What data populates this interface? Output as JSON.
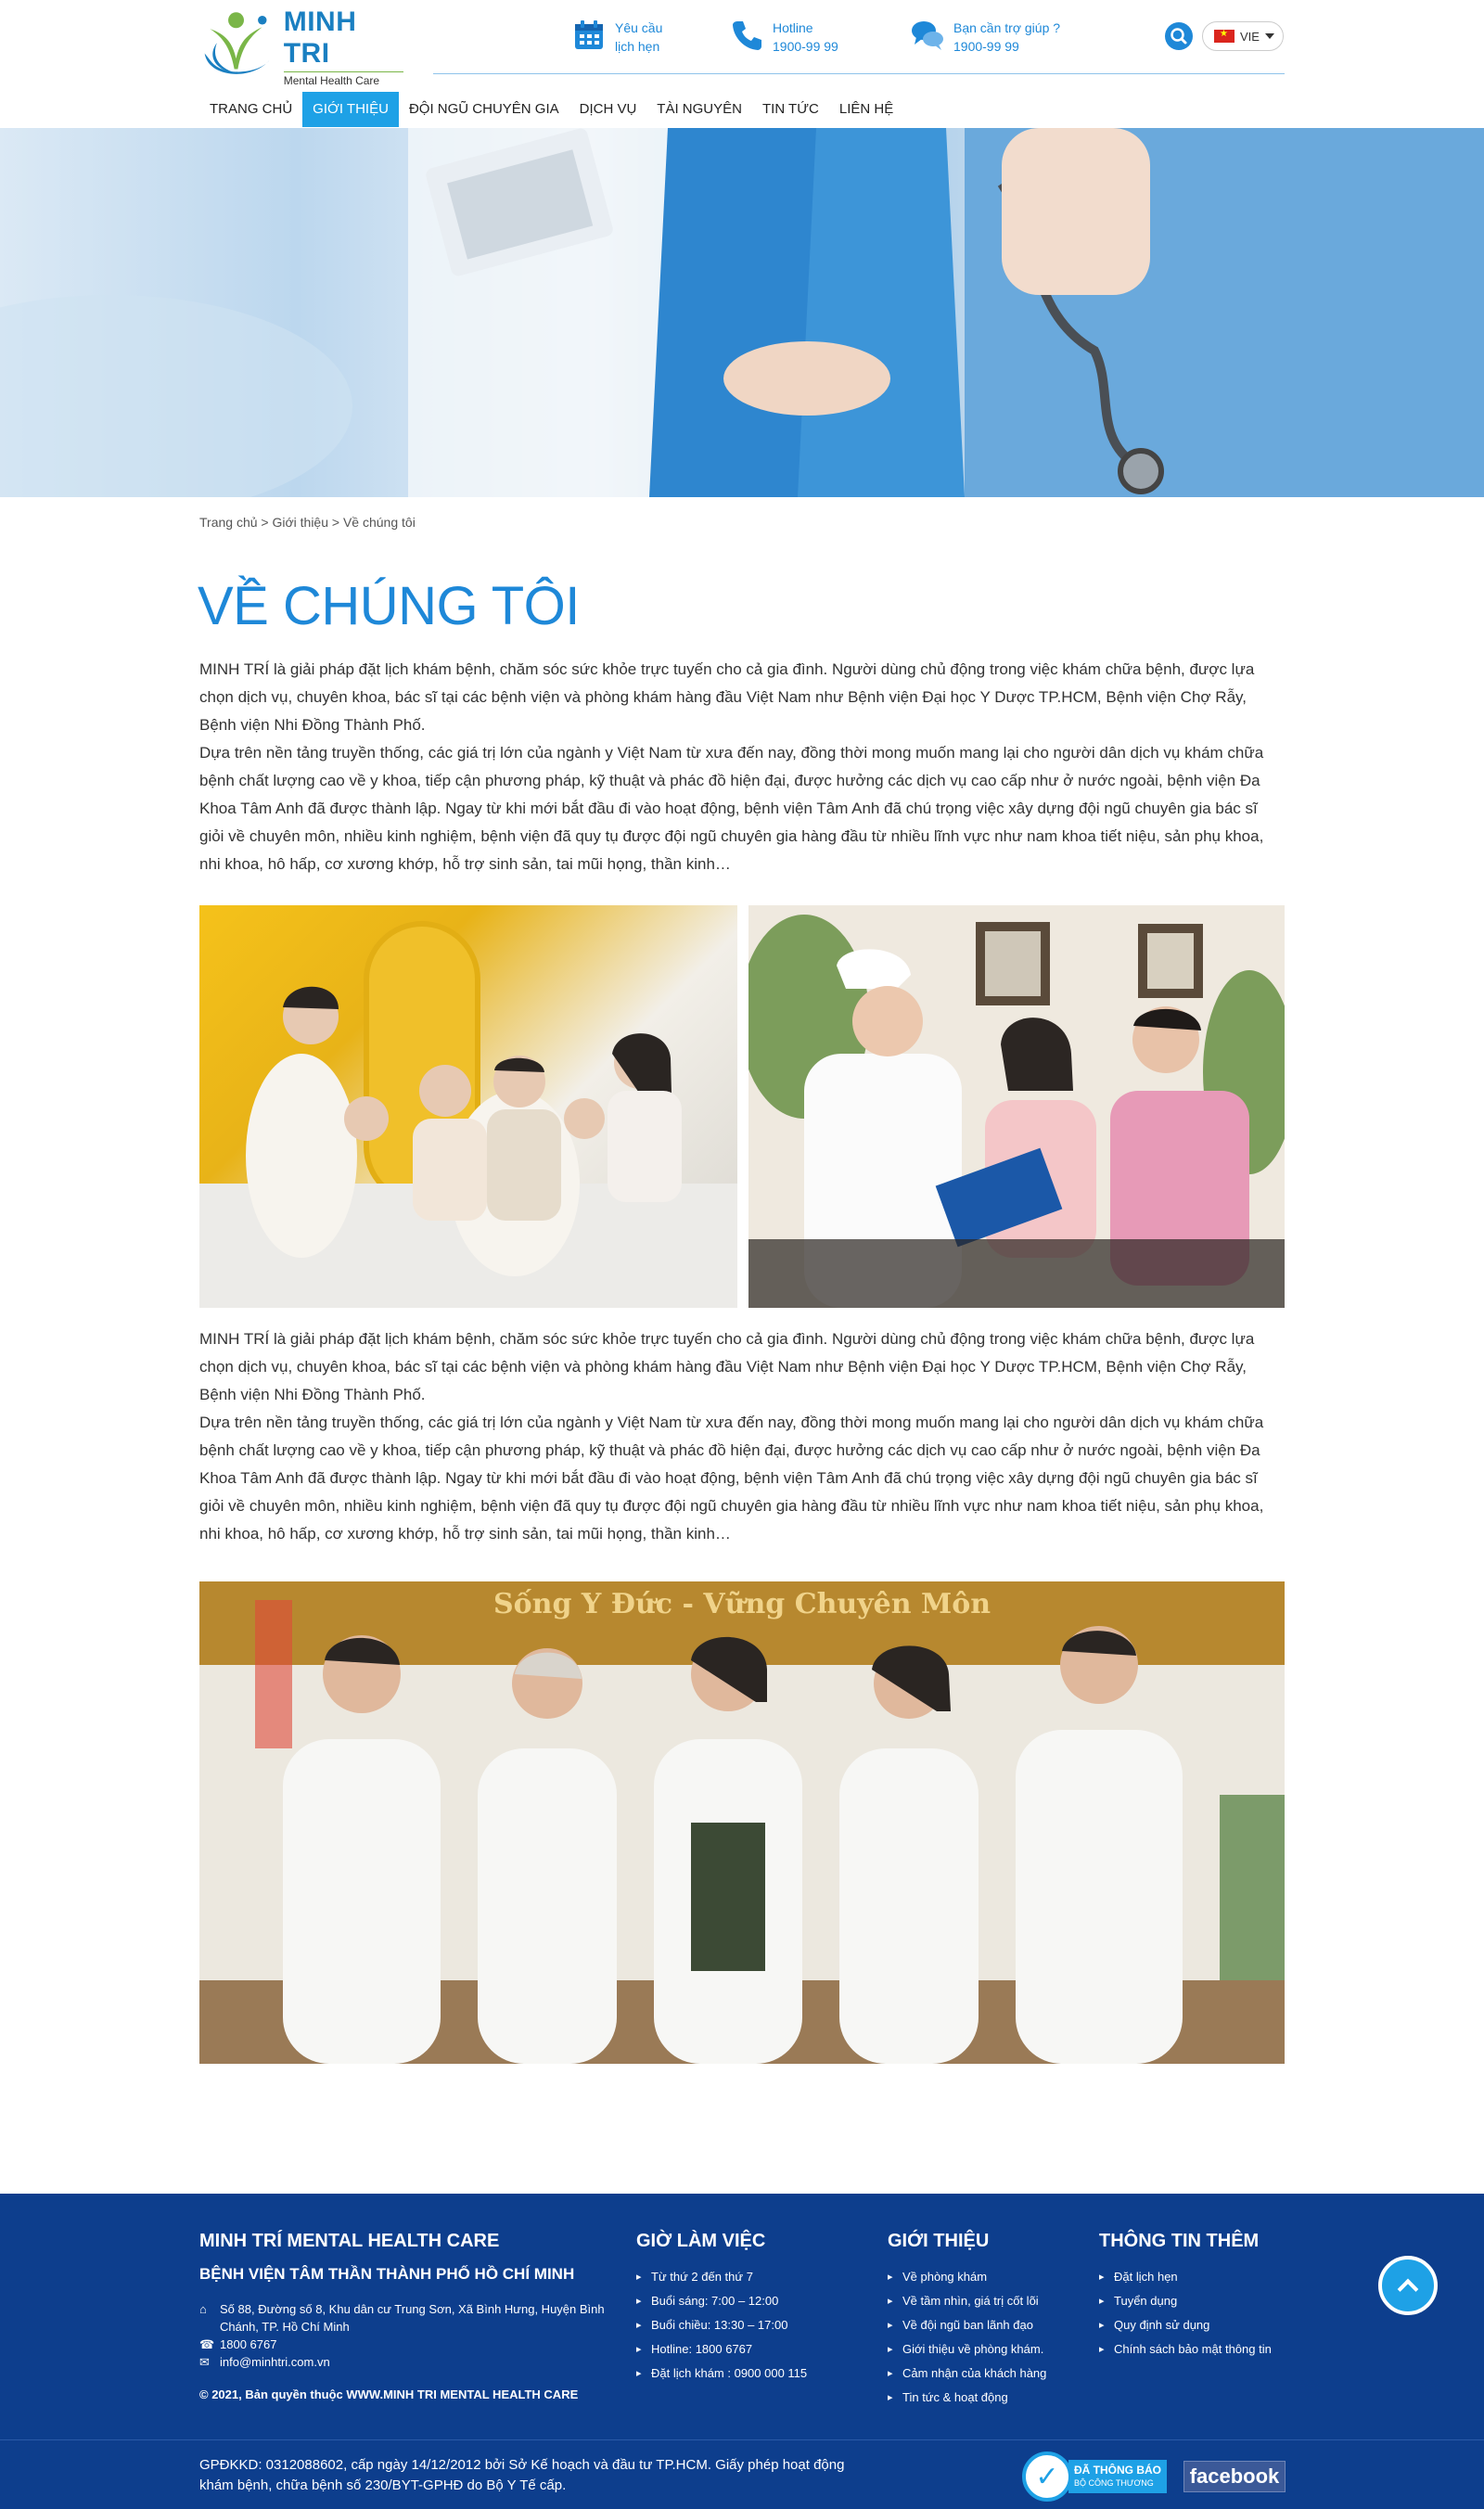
{
  "brand": {
    "name": "MINH TRI",
    "tagline": "Mental Health Care",
    "colors": {
      "primary": "#1e88d8",
      "nav_active": "#1ea1e6",
      "footer_bg": "#0d3e8d",
      "logo_green": "#7ab648"
    }
  },
  "header": {
    "contacts": [
      {
        "icon": "calendar-icon",
        "line1": "Yêu cầu",
        "line2": "lịch hẹn"
      },
      {
        "icon": "phone-icon",
        "line1": "Hotline",
        "line2": "1900-99 99"
      },
      {
        "icon": "chat-icon",
        "line1": "Bạn cần trợ giúp ?",
        "line2": "1900-99 99"
      }
    ],
    "lang": "VIE"
  },
  "nav": {
    "items": [
      "TRANG CHỦ",
      "GIỚI THIỆU",
      "ĐỘI NGŨ CHUYÊN GIA",
      "DỊCH VỤ",
      "TÀI NGUYÊN",
      "TIN TỨC",
      "LIÊN HỆ"
    ],
    "active_index": 1
  },
  "breadcrumb": "Trang chủ > Giới thiệu > Về chúng tôi",
  "page_title": "VỀ CHÚNG TÔI",
  "paragraphs": {
    "intro": "MINH TRÍ là giải pháp đặt lịch khám bệnh, chăm sóc sức khỏe trực tuyến cho cả gia đình. Người dùng chủ động trong việc khám chữa bệnh, được lựa chọn dịch vụ, chuyên khoa, bác sĩ tại các bệnh viện và phòng khám hàng đầu Việt Nam như Bệnh viện Đại học Y Dược TP.HCM, Bệnh viện Chợ Rẫy, Bệnh viện Nhi Đồng Thành Phố.",
    "history": "Dựa trên nền tảng truyền thống, các giá trị lớn của ngành y Việt Nam từ xưa đến nay, đồng thời mong muốn mang lại cho người dân dịch vụ khám chữa bệnh chất lượng cao về y khoa, tiếp cận phương pháp, kỹ thuật và phác đồ hiện đại, được hưởng các dịch vụ cao cấp như ở nước ngoài, bệnh viện Đa Khoa Tâm Anh đã được thành lập. Ngay từ khi mới bắt đầu đi vào hoạt động, bệnh viện Tâm Anh đã chú trọng việc xây dựng đội ngũ chuyên gia bác sĩ giỏi về chuyên môn, nhiều kinh nghiệm, bệnh viện đã quy tụ được đội ngũ chuyên gia hàng đầu từ nhiều lĩnh vực như nam khoa tiết niệu, sản phụ khoa, nhi khoa, hô hấp, cơ xương khớp, hỗ trợ sinh sản, tai mũi họng, thần kinh…"
  },
  "images": {
    "family_photo": "family-photo",
    "nurse_consult_photo": "nurse-consultation-photo",
    "doctors_team_photo": "doctors-team-photo",
    "team_banner_text": "Sống Y Đức - Vững Chuyên Môn"
  },
  "footer": {
    "org_title": "MINH TRÍ MENTAL HEALTH CARE",
    "org_subtitle": "BỆNH VIỆN TÂM THẦN THÀNH PHỐ HỒ CHÍ MINH",
    "address": "Số 88, Đường số 8, Khu dân cư Trung Sơn, Xã Bình Hưng, Huyện Bình Chánh, TP. Hồ Chí Minh",
    "phone": "1800 6767",
    "email": "info@minhtri.com.vn",
    "copyright": "© 2021, Bản quyền thuộc WWW.MINH TRI MENTAL HEALTH CARE",
    "hours": {
      "title": "GIỜ LÀM VIỆC",
      "items": [
        "Từ thứ 2 đến thứ 7",
        "Buổi sáng: 7:00 – 12:00",
        "Buổi chiều: 13:30 – 17:00",
        "Hotline: 1800 6767",
        "Đặt lịch khám : 0900 000 115"
      ]
    },
    "about": {
      "title": "GIỚI THIỆU",
      "items": [
        "Về phòng khám",
        "Về tầm nhìn, giá trị cốt lõi",
        "Về đội ngũ ban lãnh đạo",
        "Giới thiệu về phòng khám.",
        "Cảm nhận của khách hàng",
        "Tin tức & hoạt động"
      ]
    },
    "more": {
      "title": "THÔNG TIN THÊM",
      "items": [
        "Đặt lịch hẹn",
        "Tuyển dụng",
        "Quy định sử dụng",
        "Chính sách bảo mật thông tin"
      ]
    },
    "license": "GPĐKKD: 0312088602, cấp ngày 14/12/2012 bởi Sở Kế hoạch và đầu tư TP.HCM. Giấy phép hoạt động khám bệnh, chữa bệnh số 230/BYT-GPHĐ do Bộ Y Tế cấp.",
    "bct_label": "ĐÃ THÔNG BÁO",
    "bct_sub": "BỘ CÔNG THƯƠNG",
    "facebook_label": "facebook"
  }
}
